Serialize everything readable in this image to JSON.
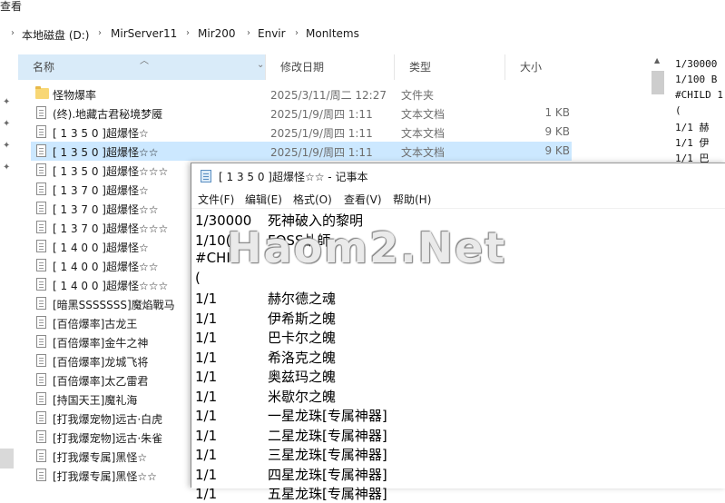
{
  "window": {
    "title_fragment": "查看"
  },
  "address_bar": {
    "crumbs": [
      "本地磁盘 (D:)",
      "MirServer11",
      "Mir200",
      "Envir",
      "MonItems"
    ]
  },
  "columns": {
    "name": "名称",
    "date": "修改日期",
    "type": "类型",
    "size": "大小"
  },
  "files": [
    {
      "name": "怪物爆率",
      "date": "2025/3/11/周二 12:27",
      "type": "文件夹",
      "size": "",
      "kind": "folder"
    },
    {
      "name": "(终).地藏古君秘境梦魇",
      "date": "2025/1/9/周四 1:11",
      "type": "文本文档",
      "size": "1 KB",
      "kind": "file"
    },
    {
      "name": "[ 1 3 5 0 ]超爆怪☆",
      "date": "2025/1/9/周四 1:11",
      "type": "文本文档",
      "size": "9 KB",
      "kind": "file"
    },
    {
      "name": "[ 1 3 5 0 ]超爆怪☆☆",
      "date": "2025/1/9/周四 1:11",
      "type": "文本文档",
      "size": "9 KB",
      "kind": "file"
    },
    {
      "name": "[ 1 3 5 0 ]超爆怪☆☆☆",
      "date": "",
      "type": "",
      "size": "",
      "kind": "file"
    },
    {
      "name": "[ 1 3 7 0 ]超爆怪☆",
      "date": "",
      "type": "",
      "size": "",
      "kind": "file"
    },
    {
      "name": "[ 1 3 7 0 ]超爆怪☆☆",
      "date": "",
      "type": "",
      "size": "",
      "kind": "file"
    },
    {
      "name": "[ 1 3 7 0 ]超爆怪☆☆☆",
      "date": "",
      "type": "",
      "size": "",
      "kind": "file"
    },
    {
      "name": "[ 1 4 0 0 ]超爆怪☆",
      "date": "",
      "type": "",
      "size": "",
      "kind": "file"
    },
    {
      "name": "[ 1 4 0 0 ]超爆怪☆☆",
      "date": "",
      "type": "",
      "size": "",
      "kind": "file"
    },
    {
      "name": "[ 1 4 0 0 ]超爆怪☆☆☆",
      "date": "",
      "type": "",
      "size": "",
      "kind": "file"
    },
    {
      "name": "[暗黑SSSSSSS]魔焰戰马",
      "date": "",
      "type": "",
      "size": "",
      "kind": "file"
    },
    {
      "name": "[百倍爆率]古龙王",
      "date": "",
      "type": "",
      "size": "",
      "kind": "file"
    },
    {
      "name": "[百倍爆率]金牛之神",
      "date": "",
      "type": "",
      "size": "",
      "kind": "file"
    },
    {
      "name": "[百倍爆率]龙城飞将",
      "date": "",
      "type": "",
      "size": "",
      "kind": "file"
    },
    {
      "name": "[百倍爆率]太乙雷君",
      "date": "",
      "type": "",
      "size": "",
      "kind": "file"
    },
    {
      "name": "[持国天王]魔礼海",
      "date": "",
      "type": "",
      "size": "",
      "kind": "file"
    },
    {
      "name": "[打我爆宠物]远古·白虎",
      "date": "",
      "type": "",
      "size": "",
      "kind": "file"
    },
    {
      "name": "[打我爆宠物]远古·朱雀",
      "date": "",
      "type": "",
      "size": "",
      "kind": "file"
    },
    {
      "name": "[打我爆专属]黑怪☆",
      "date": "",
      "type": "",
      "size": "",
      "kind": "file"
    },
    {
      "name": "[打我爆专属]黑怪☆☆",
      "date": "",
      "type": "",
      "size": "",
      "kind": "file"
    }
  ],
  "preview": {
    "lines": [
      "1/30000",
      "1/100  B",
      "#CHILD 1",
      "(",
      "1/1    赫",
      "1/1    伊",
      "1/1    巴"
    ]
  },
  "notepad": {
    "title": "[ 1 3 5 0 ]超爆怪☆☆ - 记事本",
    "menu": [
      "文件(F)",
      "编辑(E)",
      "格式(O)",
      "查看(V)",
      "帮助(H)"
    ],
    "lines": [
      {
        "a": "1/30000",
        "b": "死神破入的黎明"
      },
      {
        "a": "1/10(",
        "b": "FOSS乩師"
      },
      {
        "a": "#CHIL",
        "b": ""
      },
      {
        "a": "(",
        "b": ""
      },
      {
        "a": "1/1",
        "b": "赫尔德之魂"
      },
      {
        "a": "1/1",
        "b": "伊希斯之魄"
      },
      {
        "a": "1/1",
        "b": "巴卡尔之魄"
      },
      {
        "a": "1/1",
        "b": "希洛克之魄"
      },
      {
        "a": "1/1",
        "b": "奥兹玛之魄"
      },
      {
        "a": "1/1",
        "b": "米歇尔之魄"
      },
      {
        "a": "1/1",
        "b": "一星龙珠[专属神器]"
      },
      {
        "a": "1/1",
        "b": "二星龙珠[专属神器]"
      },
      {
        "a": "1/1",
        "b": "三星龙珠[专属神器]"
      },
      {
        "a": "1/1",
        "b": "四星龙珠[专属神器]"
      },
      {
        "a": "1/1",
        "b": "五星龙珠[专属神器]"
      }
    ]
  },
  "watermark": "Haom2.Net"
}
